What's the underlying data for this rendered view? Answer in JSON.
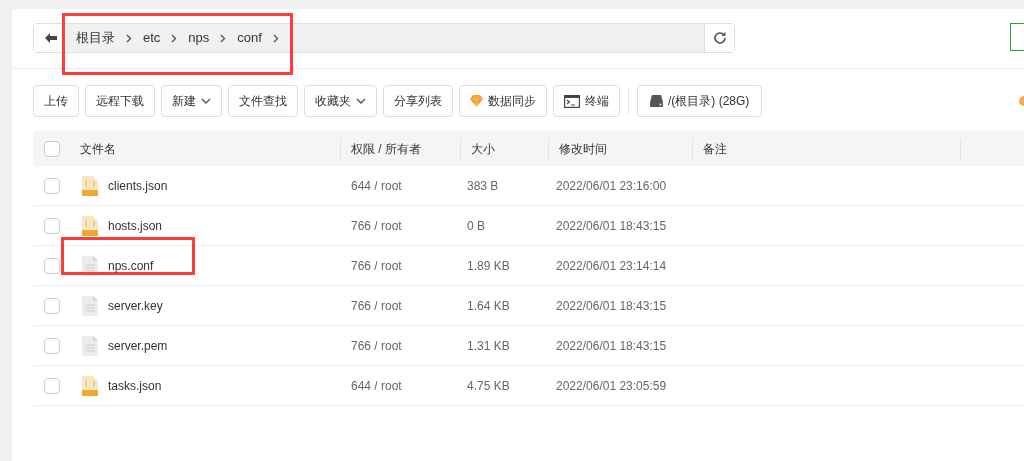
{
  "path_bar": {
    "crumbs": [
      "根目录",
      "etc",
      "nps",
      "conf"
    ],
    "highlighted": true
  },
  "toolbar": [
    {
      "label": "上传",
      "kind": "plain"
    },
    {
      "label": "远程下载",
      "kind": "plain"
    },
    {
      "label": "新建",
      "kind": "dropdown"
    },
    {
      "label": "文件查找",
      "kind": "plain"
    },
    {
      "label": "收藏夹",
      "kind": "dropdown"
    },
    {
      "label": "分享列表",
      "kind": "plain"
    },
    {
      "label": "数据同步",
      "kind": "gem"
    },
    {
      "label": "终端",
      "kind": "terminal"
    },
    {
      "label": "/(根目录) (28G)",
      "kind": "disk"
    }
  ],
  "table": {
    "all_checked": false,
    "columns": [
      "文件名",
      "权限 / 所有者",
      "大小",
      "修改时间",
      "备注"
    ],
    "rows": [
      {
        "name": "clients.json",
        "kind": "json",
        "perm": "644 / root",
        "size": "383 B",
        "modified": "2022/06/01 23:16:00",
        "checked": false,
        "highlighted": false
      },
      {
        "name": "hosts.json",
        "kind": "json",
        "perm": "766 / root",
        "size": "0 B",
        "modified": "2022/06/01 18:43:15",
        "checked": false,
        "highlighted": false
      },
      {
        "name": "nps.conf",
        "kind": "text",
        "perm": "766 / root",
        "size": "1.89 KB",
        "modified": "2022/06/01 23:14:14",
        "checked": false,
        "highlighted": true
      },
      {
        "name": "server.key",
        "kind": "text",
        "perm": "766 / root",
        "size": "1.64 KB",
        "modified": "2022/06/01 18:43:15",
        "checked": false,
        "highlighted": false
      },
      {
        "name": "server.pem",
        "kind": "text",
        "perm": "766 / root",
        "size": "1.31 KB",
        "modified": "2022/06/01 18:43:15",
        "checked": false,
        "highlighted": false
      },
      {
        "name": "tasks.json",
        "kind": "json",
        "perm": "644 / root",
        "size": "4.75 KB",
        "modified": "2022/06/01 23:05:59",
        "checked": false,
        "highlighted": false
      }
    ]
  }
}
